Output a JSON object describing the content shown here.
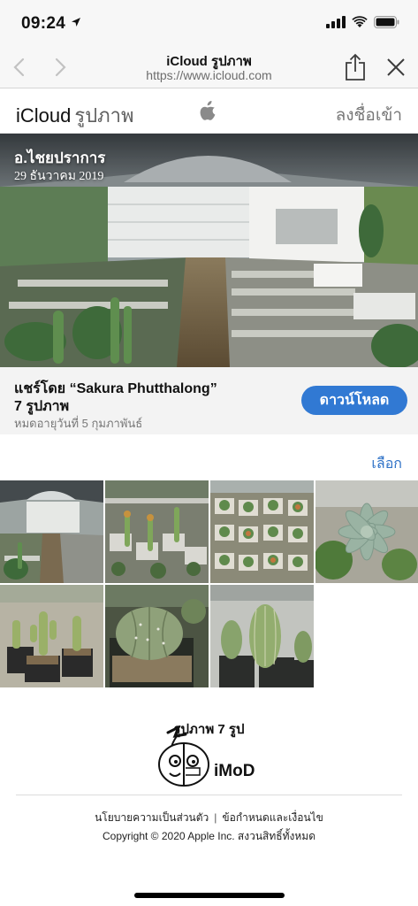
{
  "status": {
    "time": "09:24"
  },
  "browser": {
    "title": "iCloud รูปภาพ",
    "url": "https://www.icloud.com"
  },
  "header": {
    "brand_main": "iCloud",
    "brand_sub": "รูปภาพ",
    "signin": "ลงชื่อเข้า"
  },
  "album": {
    "title": "อ.ไชยปราการ",
    "date": "29 ธันวาคม 2019"
  },
  "share": {
    "shared_by": "แชร์โดย “Sakura Phutthalong”",
    "photo_count": "7 รูปภาพ",
    "expires": "หมดอายุวันที่ 5 กุมภาพันธ์",
    "download_label": "ดาวน์โหลด",
    "select_label": "เลือก"
  },
  "grid": {
    "count_label": "รูปภาพ 7 รูป"
  },
  "watermark": {
    "text": "iMoD"
  },
  "footer": {
    "privacy": "นโยบายความเป็นส่วนตัว",
    "terms": "ข้อกำหนดและเงื่อนไข",
    "copyright": "Copyright © 2020 Apple Inc. สงวนสิทธิ์ทั้งหมด"
  },
  "colors": {
    "accent": "#3179d3",
    "link": "#2f72c7"
  }
}
